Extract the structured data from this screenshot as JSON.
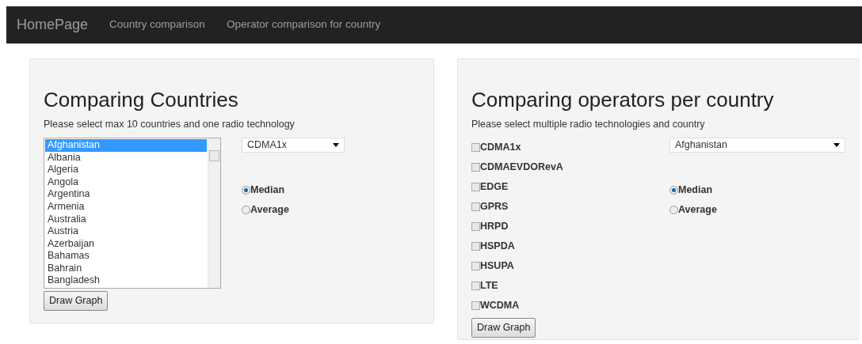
{
  "navbar": {
    "brand": "HomePage",
    "links": [
      {
        "label": "Country comparison"
      },
      {
        "label": "Operator comparison for country"
      }
    ]
  },
  "panels": [
    {
      "title": "Comparing Countries",
      "instruction": "Please select max 10 countries and one radio technology",
      "kind": "countries",
      "countries": [
        {
          "label": "Afghanistan",
          "selected": true
        },
        {
          "label": "Albania",
          "selected": false
        },
        {
          "label": "Algeria",
          "selected": false
        },
        {
          "label": "Angola",
          "selected": false
        },
        {
          "label": "Argentina",
          "selected": false
        },
        {
          "label": "Armenia",
          "selected": false
        },
        {
          "label": "Australia",
          "selected": false
        },
        {
          "label": "Austria",
          "selected": false
        },
        {
          "label": "Azerbaijan",
          "selected": false
        },
        {
          "label": "Bahamas",
          "selected": false
        },
        {
          "label": "Bahrain",
          "selected": false
        },
        {
          "label": "Bangladesh",
          "selected": false
        }
      ],
      "dropdown": "CDMA1x",
      "radios": [
        {
          "label": "Median",
          "selected": true
        },
        {
          "label": "Average",
          "selected": false
        }
      ],
      "button": "Draw Graph"
    },
    {
      "title": "Comparing operators per country",
      "instruction": "Please select multiple radio technologies and country",
      "kind": "operators",
      "technologies": [
        {
          "label": "CDMA1x",
          "checked": false
        },
        {
          "label": "CDMAEVDORevA",
          "checked": false
        },
        {
          "label": "EDGE",
          "checked": false
        },
        {
          "label": "GPRS",
          "checked": false
        },
        {
          "label": "HRPD",
          "checked": false
        },
        {
          "label": "HSPDA",
          "checked": false
        },
        {
          "label": "HSUPA",
          "checked": false
        },
        {
          "label": "LTE",
          "checked": false
        },
        {
          "label": "WCDMA",
          "checked": false
        }
      ],
      "dropdown": "Afghanistan",
      "radios": [
        {
          "label": "Median",
          "selected": true
        },
        {
          "label": "Average",
          "selected": false
        }
      ],
      "button": "Draw Graph"
    }
  ]
}
